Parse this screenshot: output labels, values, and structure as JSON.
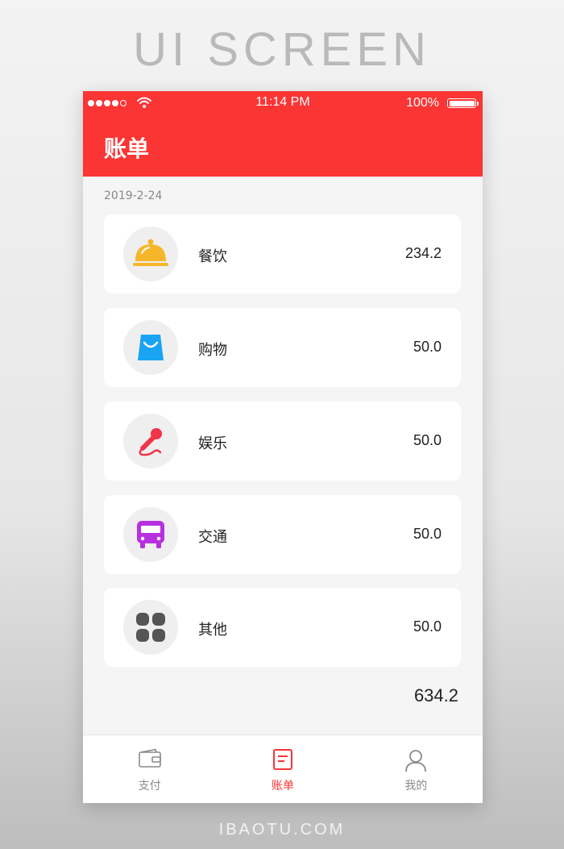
{
  "showcase": {
    "title": "UI SCREEN",
    "footer": "IBAOTU.COM"
  },
  "status_bar": {
    "time": "11:14 PM",
    "battery": "100%"
  },
  "header": {
    "title": "账单"
  },
  "bill": {
    "date": "2019-2-24",
    "items": [
      {
        "label": "餐饮",
        "amount": "234.2",
        "icon": "dish-cover-icon",
        "color": "#f5b72a"
      },
      {
        "label": "购物",
        "amount": "50.0",
        "icon": "shopping-bag-icon",
        "color": "#1aa3f2"
      },
      {
        "label": "娱乐",
        "amount": "50.0",
        "icon": "microphone-icon",
        "color": "#f0354a"
      },
      {
        "label": "交通",
        "amount": "50.0",
        "icon": "bus-icon",
        "color": "#b730e0"
      },
      {
        "label": "其他",
        "amount": "50.0",
        "icon": "grid-icon",
        "color": "#555555"
      }
    ],
    "total": "634.2"
  },
  "tabs": [
    {
      "label": "支付",
      "icon": "wallet-icon",
      "active": false
    },
    {
      "label": "账单",
      "icon": "bill-icon",
      "active": true
    },
    {
      "label": "我的",
      "icon": "user-icon",
      "active": false
    }
  ],
  "colors": {
    "accent": "#fb3434",
    "background": "#f5f5f5"
  }
}
